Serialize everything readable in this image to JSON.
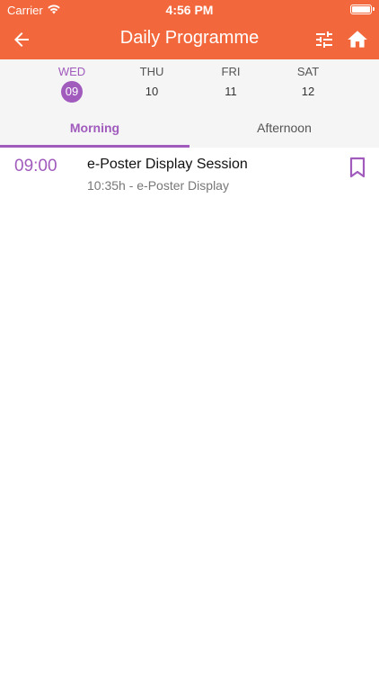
{
  "status_bar": {
    "carrier": "Carrier",
    "time": "4:56 PM"
  },
  "nav": {
    "title": "Daily Programme"
  },
  "days": [
    {
      "name": "WED",
      "num": "09",
      "active": true
    },
    {
      "name": "THU",
      "num": "10",
      "active": false
    },
    {
      "name": "FRI",
      "num": "11",
      "active": false
    },
    {
      "name": "SAT",
      "num": "12",
      "active": false
    }
  ],
  "tabs": [
    {
      "label": "Morning",
      "active": true
    },
    {
      "label": "Afternoon",
      "active": false
    }
  ],
  "sessions": [
    {
      "time": "09:00",
      "title": "e-Poster Display Session",
      "subtitle": "10:35h - e-Poster Display"
    }
  ],
  "colors": {
    "header": "#f2683c",
    "accent": "#a05bbd",
    "background": "#f5f5f5"
  },
  "icons": {
    "back": "arrow-left-icon",
    "filter": "sliders-icon",
    "home": "home-icon",
    "bookmark": "bookmark-icon"
  }
}
